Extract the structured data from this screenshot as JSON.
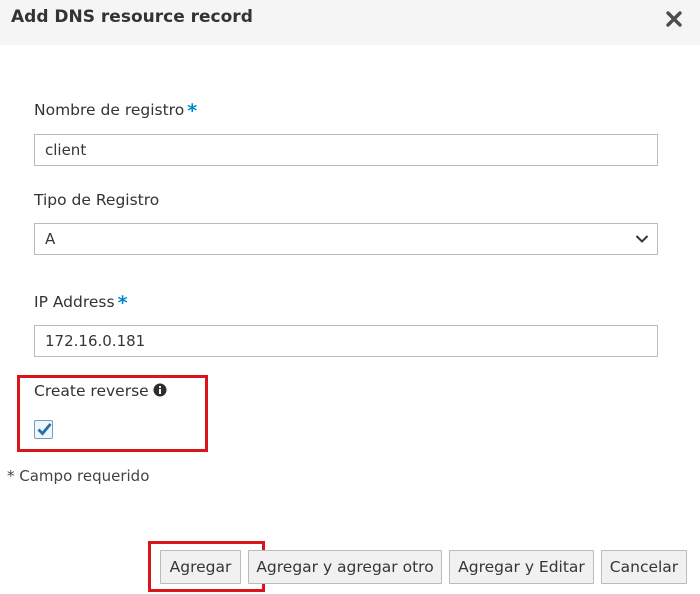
{
  "dialog": {
    "title": "Add DNS resource record"
  },
  "form": {
    "record_name": {
      "label": "Nombre de registro",
      "required_marker": "*",
      "value": "client"
    },
    "record_type": {
      "label": "Tipo de Registro",
      "selected": "A"
    },
    "ip_address": {
      "label": "IP Address",
      "required_marker": "*",
      "value": "172.16.0.181"
    },
    "create_reverse": {
      "label": "Create reverse",
      "checked": true
    },
    "required_note": "* Campo requerido"
  },
  "buttons": {
    "add": "Agregar",
    "add_and_add_another": "Agregar y agregar otro",
    "add_and_edit": "Agregar y Editar",
    "cancel": "Cancelar"
  },
  "colors": {
    "accent": "#0088ce",
    "highlight": "#d9141d",
    "header_bg": "#f5f5f5"
  }
}
